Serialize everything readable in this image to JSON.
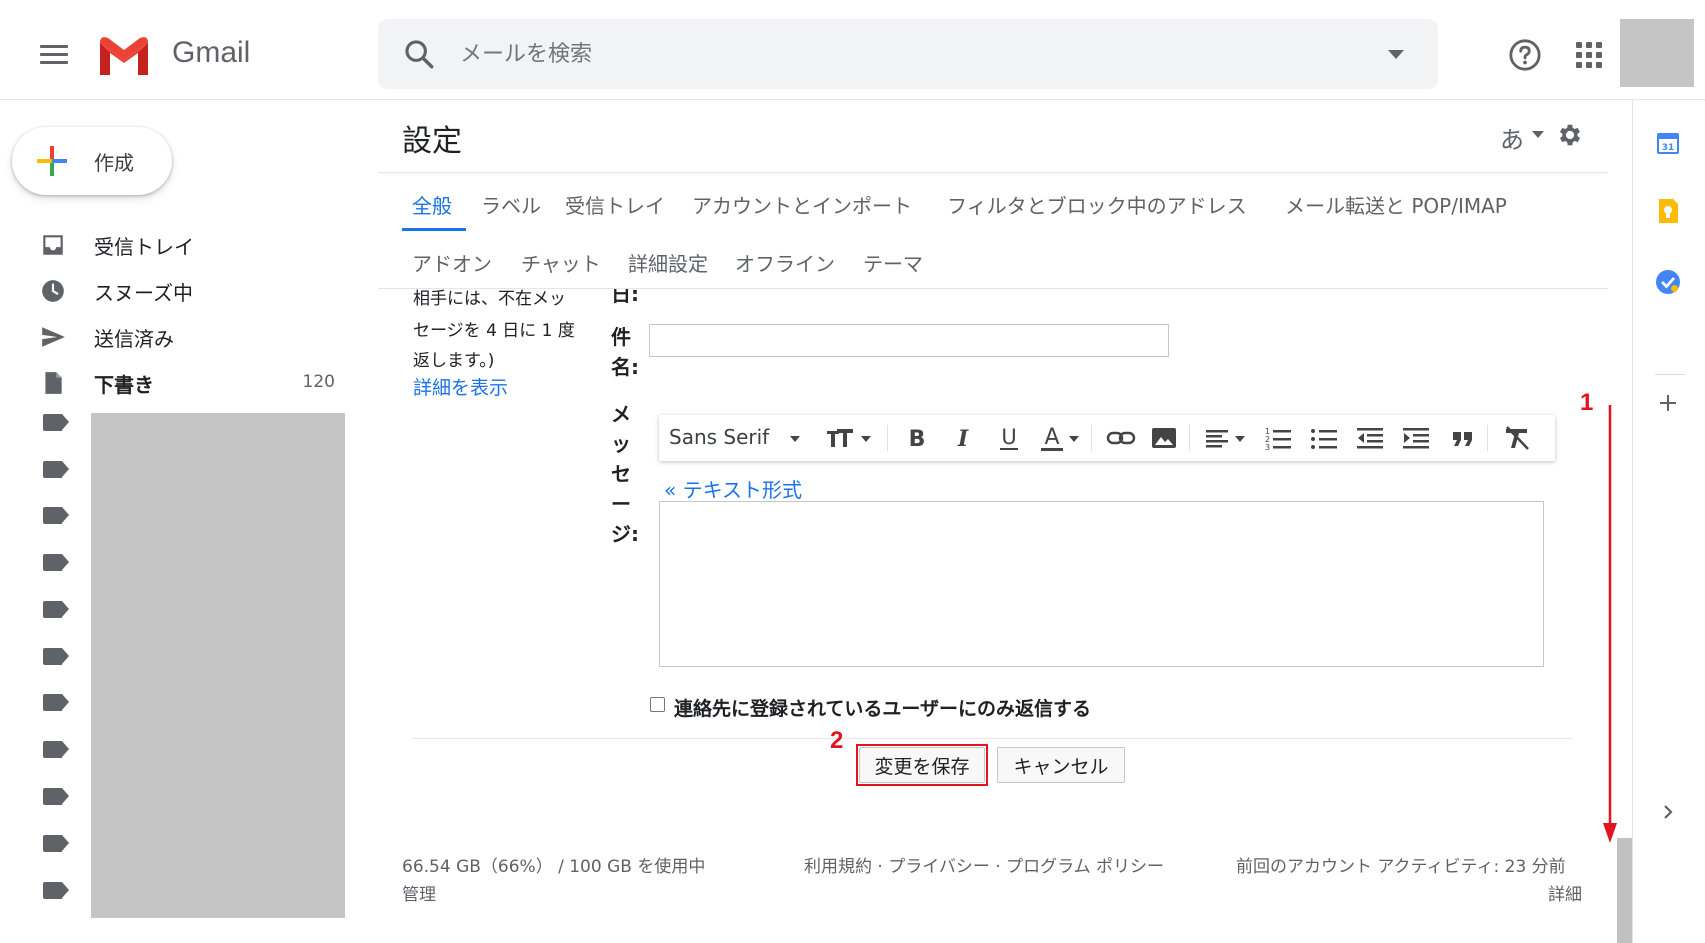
{
  "header": {
    "app_name": "Gmail",
    "search_placeholder": "メールを検索"
  },
  "sidebar": {
    "compose_label": "作成",
    "items": [
      {
        "label": "受信トレイ",
        "icon": "inbox-icon"
      },
      {
        "label": "スヌーズ中",
        "icon": "clock-icon"
      },
      {
        "label": "送信済み",
        "icon": "send-icon"
      },
      {
        "label": "下書き",
        "icon": "draft-icon",
        "count": "120"
      }
    ]
  },
  "settings": {
    "title": "設定",
    "lang_label": "あ",
    "tabs_row1": [
      "全般",
      "ラベル",
      "受信トレイ",
      "アカウントとインポート",
      "フィルタとブロック中のアドレス",
      "メール転送と POP/IMAP"
    ],
    "tabs_row2": [
      "アドオン",
      "チャット",
      "詳細設定",
      "オフライン",
      "テーマ"
    ],
    "active_tab": "全般",
    "vacation_text_lines": [
      "相手には、不在メッ",
      "セージを 4 日に 1 度",
      "返します。)"
    ],
    "details_link": "詳細を表示",
    "date_label_tail": "日:",
    "subject_label": "件名:",
    "message_label": "メッセージ:",
    "font_name": "Sans Serif",
    "text_format_link": "« テキスト形式",
    "contacts_only_label": "連絡先に登録されているユーザーにのみ返信する",
    "save_label": "変更を保存",
    "cancel_label": "キャンセル"
  },
  "annotations": {
    "step1": "1",
    "step2": "2",
    "color": "#e1151f"
  },
  "footer": {
    "storage": "66.54 GB（66%） / 100 GB を使用中",
    "manage": "管理",
    "terms": "利用規約",
    "privacy": "プライバシー",
    "program_policy": "プログラム ポリシー",
    "separator": "·",
    "last_activity": "前回のアカウント アクティビティ: 23 分前",
    "details": "詳細"
  },
  "colors": {
    "accent": "#1a73e8",
    "gmail_red": "#ea4335"
  }
}
